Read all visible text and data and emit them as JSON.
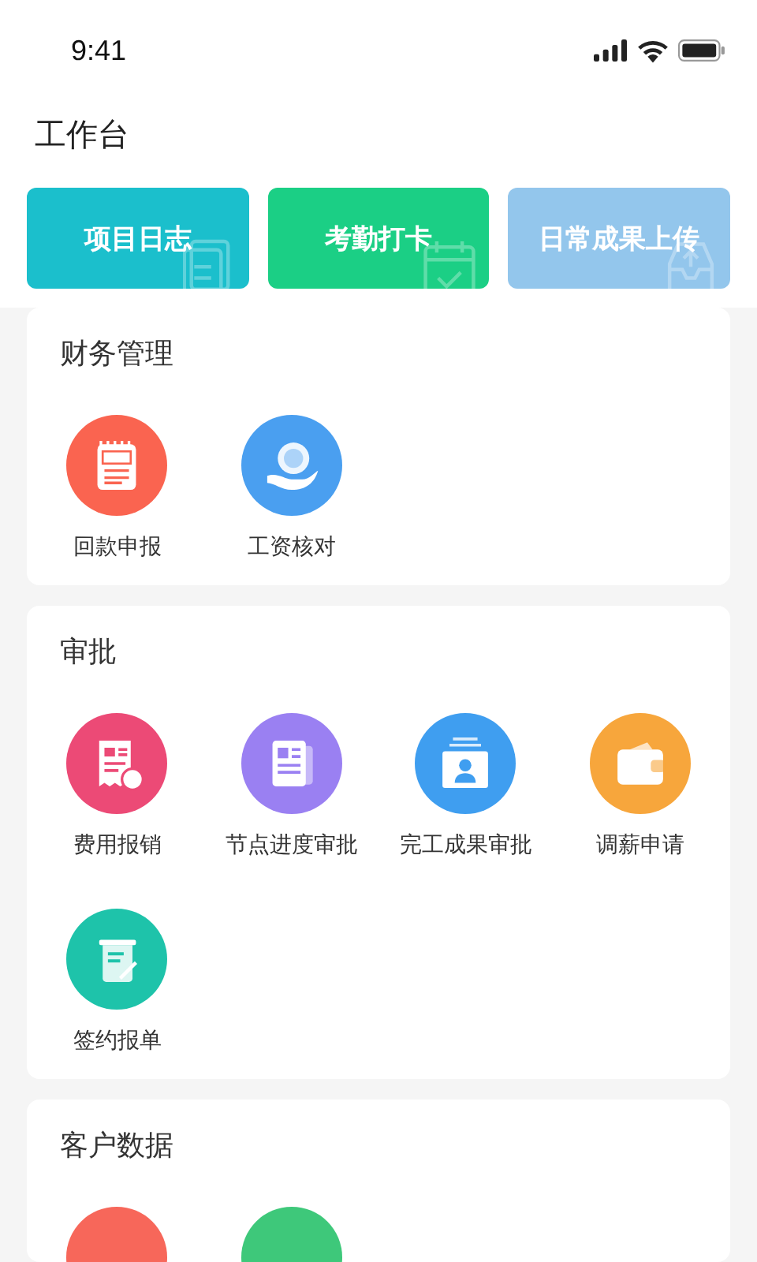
{
  "status_bar": {
    "time": "9:41"
  },
  "page_title": "工作台",
  "quick_actions": [
    {
      "label": "项目日志",
      "color": "#1bbfcc",
      "kind": "document"
    },
    {
      "label": "考勤打卡",
      "color": "#1bcf85",
      "kind": "calendar"
    },
    {
      "label": "日常成果上传",
      "color": "#93c6ec",
      "kind": "upload"
    }
  ],
  "sections": [
    {
      "title": "财务管理",
      "items": [
        {
          "label": "回款申报",
          "color": "#fa6450",
          "kind": "notepad"
        },
        {
          "label": "工资核对",
          "color": "#4a9ff0",
          "kind": "coin"
        }
      ]
    },
    {
      "title": "审批",
      "items": [
        {
          "label": "费用报销",
          "color": "#ec4a76",
          "kind": "receipt"
        },
        {
          "label": "节点进度审批",
          "color": "#9a80f2",
          "kind": "document"
        },
        {
          "label": "完工成果审批",
          "color": "#3f9ef0",
          "kind": "portrait"
        },
        {
          "label": "调薪申请",
          "color": "#f7a63c",
          "kind": "wallet"
        },
        {
          "label": "签约报单",
          "color": "#1ec3aa",
          "kind": "note"
        }
      ]
    },
    {
      "title": "客户数据",
      "items": [
        {
          "color": "#f7675a",
          "kind": "blank"
        },
        {
          "color": "#3ec87a",
          "kind": "blank"
        }
      ]
    }
  ]
}
